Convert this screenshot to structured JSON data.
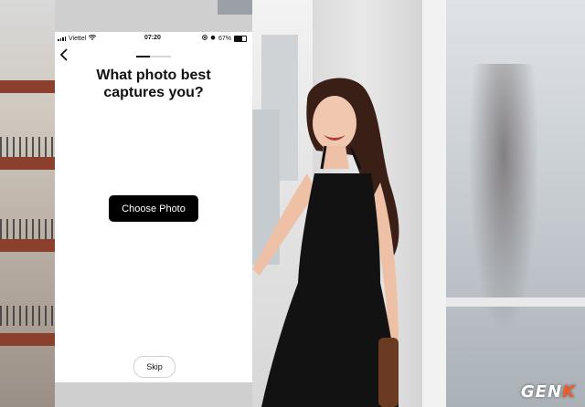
{
  "status_bar": {
    "carrier": "Viettel",
    "time": "07:20",
    "battery": "67%"
  },
  "onboarding": {
    "title_line1": "What photo best",
    "title_line2": "captures you?",
    "choose_button": "Choose Photo",
    "skip_button": "Skip",
    "progress": 0.4
  },
  "watermark": {
    "prefix": "GEN",
    "accent": "K"
  },
  "colors": {
    "primary_button_bg": "#000000",
    "screen_bg": "#ffffff",
    "watermark_accent": "#f25a2a"
  },
  "icons": [
    "signal-bars-icon",
    "wifi-icon",
    "location-icon",
    "alarm-icon",
    "battery-icon",
    "back-chevron-icon"
  ]
}
